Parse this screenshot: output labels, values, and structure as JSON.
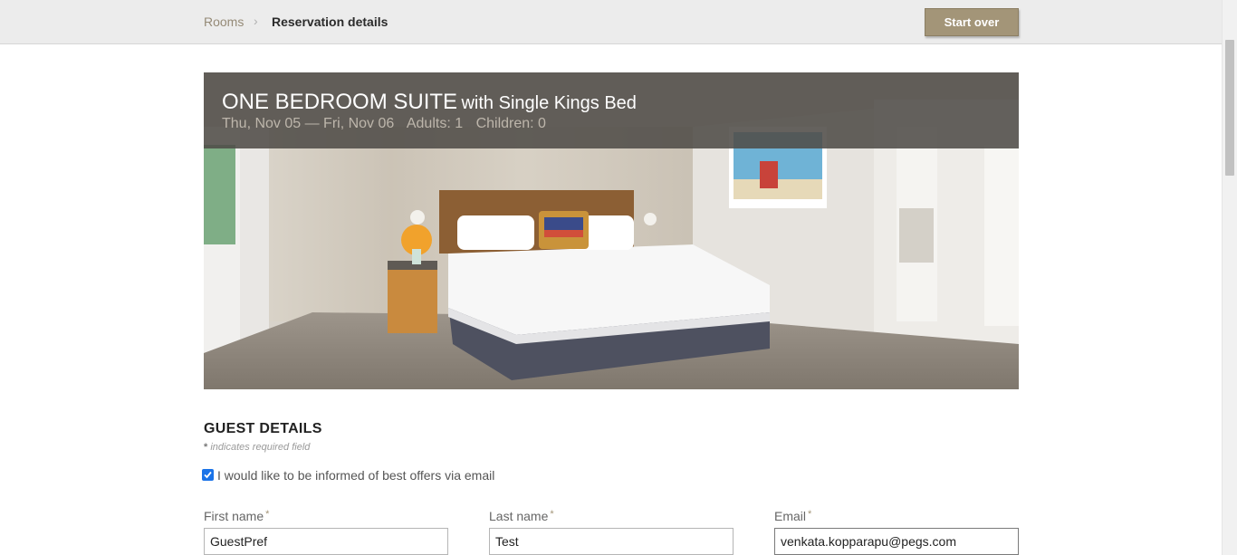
{
  "breadcrumb": {
    "rooms_label": "Rooms",
    "separator": "›",
    "current_label": "Reservation details"
  },
  "header": {
    "start_over_label": "Start over"
  },
  "room": {
    "name": "ONE BEDROOM SUITE",
    "subtitle": "with Single Kings Bed",
    "dates": "Thu, Nov 05 — Fri, Nov 06",
    "adults": "Adults: 1",
    "children": "Children: 0"
  },
  "guest_details": {
    "title": "GUEST DETAILS",
    "required_marker": "*",
    "required_note": " indicates required field",
    "offers_checkbox_label": "I would like to be informed of best offers via email",
    "offers_checked": true,
    "fields": [
      {
        "label": "First name",
        "required_marker": "*",
        "value": "GuestPref"
      },
      {
        "label": "Last name",
        "required_marker": "*",
        "value": "Test"
      },
      {
        "label": "Email",
        "required_marker": "*",
        "value": "venkata.kopparapu@pegs.com"
      }
    ]
  },
  "colors": {
    "accent": "#a39578",
    "checkbox": "#1a73e8",
    "hero_overlay": "#504c48"
  }
}
